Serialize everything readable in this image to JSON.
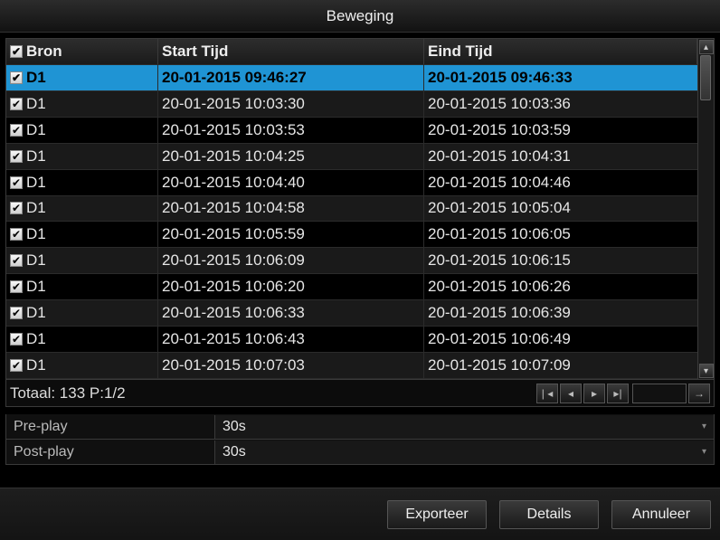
{
  "title": "Beweging",
  "columns": {
    "source": "Bron",
    "start": "Start Tijd",
    "end": "Eind Tijd"
  },
  "rows": [
    {
      "src": "D1",
      "start": "20-01-2015 09:46:27",
      "end": "20-01-2015 09:46:33",
      "checked": true,
      "selected": true
    },
    {
      "src": "D1",
      "start": "20-01-2015 10:03:30",
      "end": "20-01-2015 10:03:36",
      "checked": true
    },
    {
      "src": "D1",
      "start": "20-01-2015 10:03:53",
      "end": "20-01-2015 10:03:59",
      "checked": true
    },
    {
      "src": "D1",
      "start": "20-01-2015 10:04:25",
      "end": "20-01-2015 10:04:31",
      "checked": true
    },
    {
      "src": "D1",
      "start": "20-01-2015 10:04:40",
      "end": "20-01-2015 10:04:46",
      "checked": true
    },
    {
      "src": "D1",
      "start": "20-01-2015 10:04:58",
      "end": "20-01-2015 10:05:04",
      "checked": true
    },
    {
      "src": "D1",
      "start": "20-01-2015 10:05:59",
      "end": "20-01-2015 10:06:05",
      "checked": true
    },
    {
      "src": "D1",
      "start": "20-01-2015 10:06:09",
      "end": "20-01-2015 10:06:15",
      "checked": true
    },
    {
      "src": "D1",
      "start": "20-01-2015 10:06:20",
      "end": "20-01-2015 10:06:26",
      "checked": true
    },
    {
      "src": "D1",
      "start": "20-01-2015 10:06:33",
      "end": "20-01-2015 10:06:39",
      "checked": true
    },
    {
      "src": "D1",
      "start": "20-01-2015 10:06:43",
      "end": "20-01-2015 10:06:49",
      "checked": true
    },
    {
      "src": "D1",
      "start": "20-01-2015 10:07:03",
      "end": "20-01-2015 10:07:09",
      "checked": true
    }
  ],
  "header_checked": true,
  "pager": {
    "status": "Totaal:  133  P:1/2",
    "page_input": ""
  },
  "options": {
    "preplay": {
      "label": "Pre-play",
      "value": "30s"
    },
    "postplay": {
      "label": "Post-play",
      "value": "30s"
    }
  },
  "buttons": {
    "export": "Exporteer",
    "details": "Details",
    "cancel": "Annuleer"
  }
}
